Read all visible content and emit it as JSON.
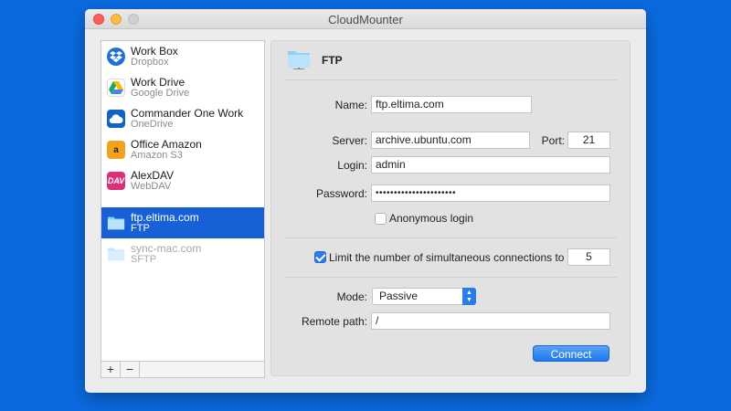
{
  "window": {
    "title": "CloudMounter"
  },
  "sidebar": {
    "accounts": [
      {
        "name": "Work Box",
        "service": "Dropbox",
        "icon": "dropbox-icon"
      },
      {
        "name": "Work Drive",
        "service": "Google Drive",
        "icon": "google-drive-icon"
      },
      {
        "name": "Commander One Work",
        "service": "OneDrive",
        "icon": "onedrive-icon"
      },
      {
        "name": "Office Amazon",
        "service": "Amazon S3",
        "icon": "amazon-s3-icon",
        "glyph": "a"
      },
      {
        "name": "AlexDAV",
        "service": "WebDAV",
        "icon": "webdav-icon",
        "glyph": "DAV"
      },
      {
        "name": "ftp.eltima.com",
        "service": "FTP",
        "icon": "folder-icon",
        "selected": true
      },
      {
        "name": "sync-mac.com",
        "service": "SFTP",
        "icon": "folder-icon"
      }
    ],
    "add_label": "+",
    "remove_label": "−"
  },
  "panel": {
    "title": "FTP",
    "name_label": "Name:",
    "name_value": "ftp.eltima.com",
    "server_label": "Server:",
    "server_value": "archive.ubuntu.com",
    "port_label": "Port:",
    "port_value": "21",
    "login_label": "Login:",
    "login_value": "admin",
    "password_label": "Password:",
    "password_value": "••••••••••••••••••••••",
    "anonymous_label": "Anonymous login",
    "anonymous_checked": false,
    "limit_label": "Limit the number of simultaneous connections to",
    "limit_checked": true,
    "limit_value": "5",
    "mode_label": "Mode:",
    "mode_value": "Passive",
    "remote_path_label": "Remote path:",
    "remote_path_value": "/",
    "connect_label": "Connect"
  },
  "colors": {
    "desktop": "#0a6be0",
    "selection": "#1760d6",
    "accent": "#2a7ce8"
  }
}
